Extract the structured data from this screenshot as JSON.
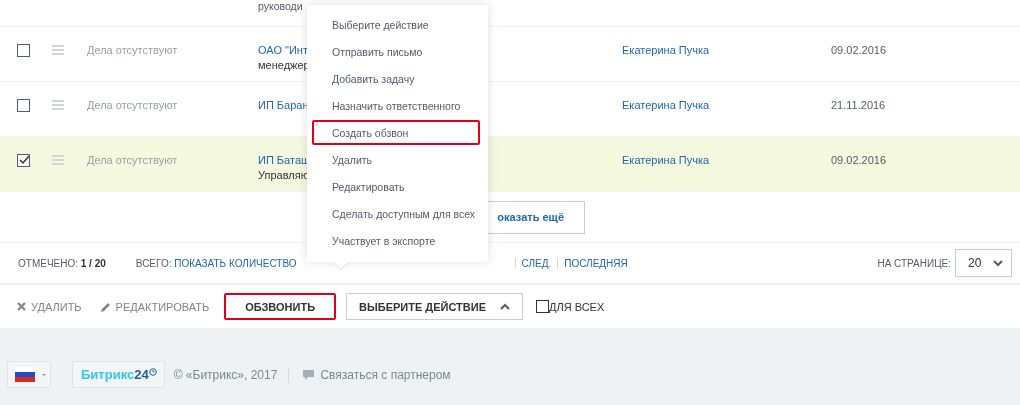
{
  "grid": {
    "partial_row": {
      "note": "руководи"
    },
    "rows": [
      {
        "checked": false,
        "activity": "Дела отсутствуют",
        "company": "ОАО \"Инт",
        "company_note": "менеджер",
        "responsible": "Екатерина Пучка",
        "date": "09.02.2016"
      },
      {
        "checked": false,
        "activity": "Дела отсутствуют",
        "company": "ИП Баран",
        "responsible": "Екатерина Пучка",
        "date": "21.11.2016"
      },
      {
        "checked": true,
        "activity": "Дела отсутствуют",
        "company": "ИП Баташ",
        "company_note": "Управляю",
        "responsible": "Екатерина Пучка",
        "date": "09.02.2016"
      }
    ],
    "show_more": "оказать ещё"
  },
  "pager": {
    "checked_label": "ОТМЕЧЕНО:",
    "checked_value": "1 / 20",
    "total_label": "ВСЕГО:",
    "total_link": "ПОКАЗАТЬ КОЛИЧЕСТВО",
    "links": [
      "СЛЕД.",
      "ПОСЛЕДНЯЯ"
    ],
    "per_page_label": "НА СТРАНИЦЕ:",
    "per_page": "20"
  },
  "actions": {
    "buttons": [
      {
        "kind": "delete",
        "label": "УДАЛИТЬ",
        "highlighted": false
      },
      {
        "kind": "edit",
        "label": "РЕДАКТИРОВАТЬ",
        "highlighted": false
      },
      {
        "kind": "plain",
        "label": "ОБЗВОНИТЬ",
        "highlighted": true
      }
    ],
    "dropdown": {
      "label": "ВЫБЕРИТЕ ДЕЙСТВИЕ",
      "expanded": true
    },
    "for_all": {
      "label": "ДЛЯ ВСЕХ",
      "checked": false
    }
  },
  "menu": {
    "items": [
      {
        "label": "Выберите действие",
        "highlighted": false
      },
      {
        "label": "Отправить письмо",
        "highlighted": false
      },
      {
        "label": "Добавить задачу",
        "highlighted": false
      },
      {
        "label": "Назначить ответственного",
        "highlighted": false
      },
      {
        "label": "Создать обзвон",
        "highlighted": true
      },
      {
        "label": "Удалить",
        "highlighted": false
      },
      {
        "label": "Редактировать",
        "highlighted": false
      },
      {
        "label": "Сделать доступным для всех",
        "highlighted": false
      },
      {
        "label": "Участвует в экспорте",
        "highlighted": false
      }
    ]
  },
  "footer": {
    "logo_name": "Битрикс",
    "logo_number": "24",
    "copyright": "© «Битрикс», 2017",
    "partner_link": "Связаться с партнером"
  }
}
